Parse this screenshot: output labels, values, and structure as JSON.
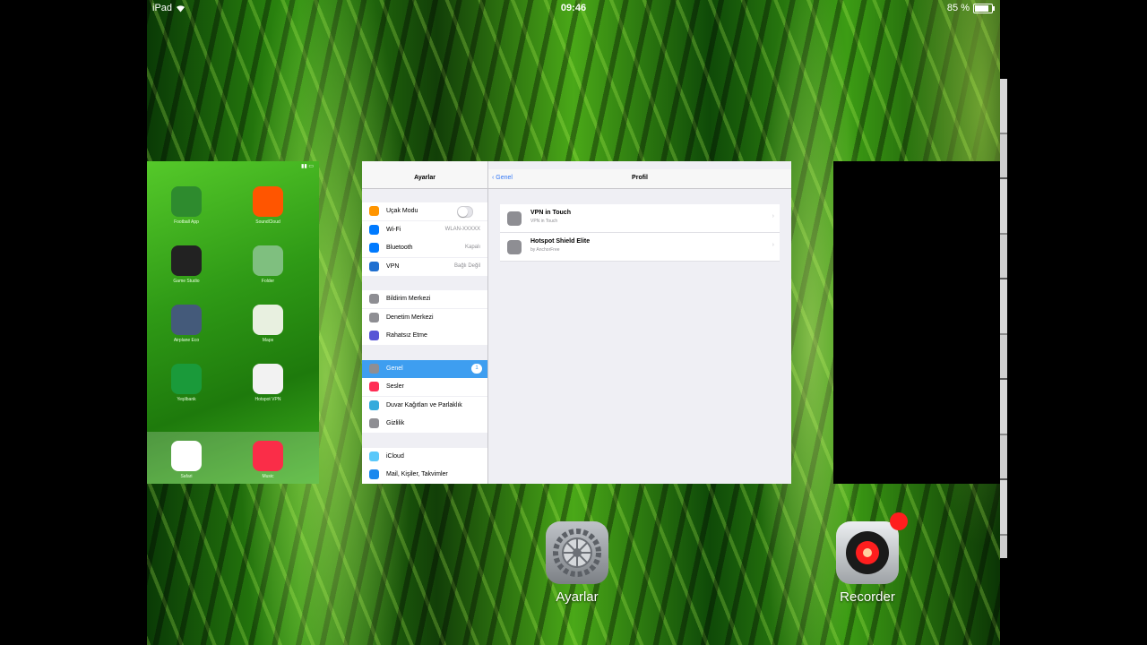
{
  "status_bar": {
    "device": "iPad",
    "time": "09:46",
    "battery": "85 %",
    "battery_level": 0.85
  },
  "home_card": {
    "apps": [
      {
        "label": "Football App",
        "icon": "football-icon",
        "color": "#2e8b2e"
      },
      {
        "label": "SoundCloud",
        "icon": "soundcloud-icon",
        "color": "#ff5500"
      },
      {
        "label": "Game Studio",
        "icon": "gamepad-icon",
        "color": "#222222"
      },
      {
        "label": "Folder",
        "icon": "folder-icon",
        "color": "#7fbf7f"
      },
      {
        "label": "Airplane Eco",
        "icon": "airplane-icon",
        "color": "#445a7a"
      },
      {
        "label": "Maps",
        "icon": "maps-icon",
        "color": "#e8f0e0"
      },
      {
        "label": "Yeşilbank",
        "icon": "bank-icon",
        "color": "#1a9a3a"
      },
      {
        "label": "Hotspot VPN",
        "icon": "shield-icon",
        "color": "#f2f2f2"
      }
    ],
    "dock": [
      {
        "label": "Safari",
        "icon": "safari-icon",
        "color": "#ffffff"
      },
      {
        "label": "Music",
        "icon": "music-icon",
        "color": "#fa2d48"
      }
    ]
  },
  "settings": {
    "title": "Ayarlar",
    "groups": [
      [
        {
          "label": "Uçak Modu",
          "value": "",
          "toggle": true,
          "color": "#ff9500"
        },
        {
          "label": "Wi-Fi",
          "value": "WLAN-XXXXX",
          "color": "#007aff"
        },
        {
          "label": "Bluetooth",
          "value": "Kapalı",
          "color": "#007aff"
        },
        {
          "label": "VPN",
          "value": "Bağlı Değil",
          "color": "#1f6fd0"
        }
      ],
      [
        {
          "label": "Bildirim Merkezi",
          "value": "",
          "color": "#8e8e93"
        },
        {
          "label": "Denetim Merkezi",
          "value": "",
          "color": "#8e8e93"
        },
        {
          "label": "Rahatsız Etme",
          "value": "",
          "color": "#5856d6"
        }
      ],
      [
        {
          "label": "Genel",
          "value": "",
          "badge": "1",
          "selected": true,
          "color": "#8e8e93"
        },
        {
          "label": "Sesler",
          "value": "",
          "color": "#ff2d55"
        },
        {
          "label": "Duvar Kağıtları ve Parlaklık",
          "value": "",
          "color": "#34aadc"
        },
        {
          "label": "Gizlilik",
          "value": "",
          "color": "#8e8e93"
        }
      ],
      [
        {
          "label": "iCloud",
          "value": "",
          "color": "#5ac8fa"
        },
        {
          "label": "Mail, Kişiler, Takvimler",
          "value": "",
          "color": "#1b88ee"
        }
      ]
    ],
    "detail": {
      "back": "Genel",
      "title": "Profil",
      "items": [
        {
          "name": "VPN in Touch",
          "sub": "VPN in Touch"
        },
        {
          "name": "Hotspot Shield Elite",
          "sub": "by AnchorFree"
        }
      ]
    }
  },
  "dock_apps": {
    "settings": "Ayarlar",
    "recorder": "Recorder"
  }
}
